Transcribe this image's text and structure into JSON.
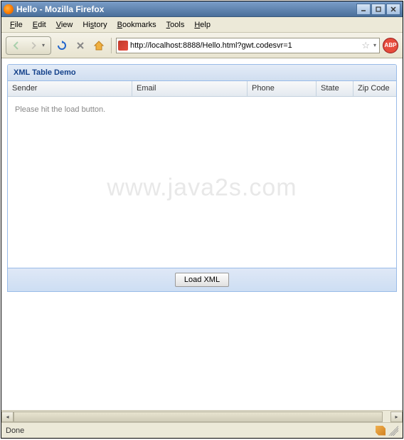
{
  "window": {
    "title": "Hello - Mozilla Firefox"
  },
  "menubar": {
    "items": [
      {
        "label": "File",
        "key": "F"
      },
      {
        "label": "Edit",
        "key": "E"
      },
      {
        "label": "View",
        "key": "V"
      },
      {
        "label": "History",
        "key": "S"
      },
      {
        "label": "Bookmarks",
        "key": "B"
      },
      {
        "label": "Tools",
        "key": "T"
      },
      {
        "label": "Help",
        "key": "H"
      }
    ]
  },
  "toolbar": {
    "url": "http://localhost:8888/Hello.html?gwt.codesvr=1",
    "abp": "ABP"
  },
  "panel": {
    "title": "XML Table Demo",
    "columns": [
      "Sender",
      "Email",
      "Phone",
      "State",
      "Zip Code"
    ],
    "empty_message": "Please hit the load button.",
    "load_button": "Load XML"
  },
  "watermark": "www.java2s.com",
  "statusbar": {
    "text": "Done"
  }
}
